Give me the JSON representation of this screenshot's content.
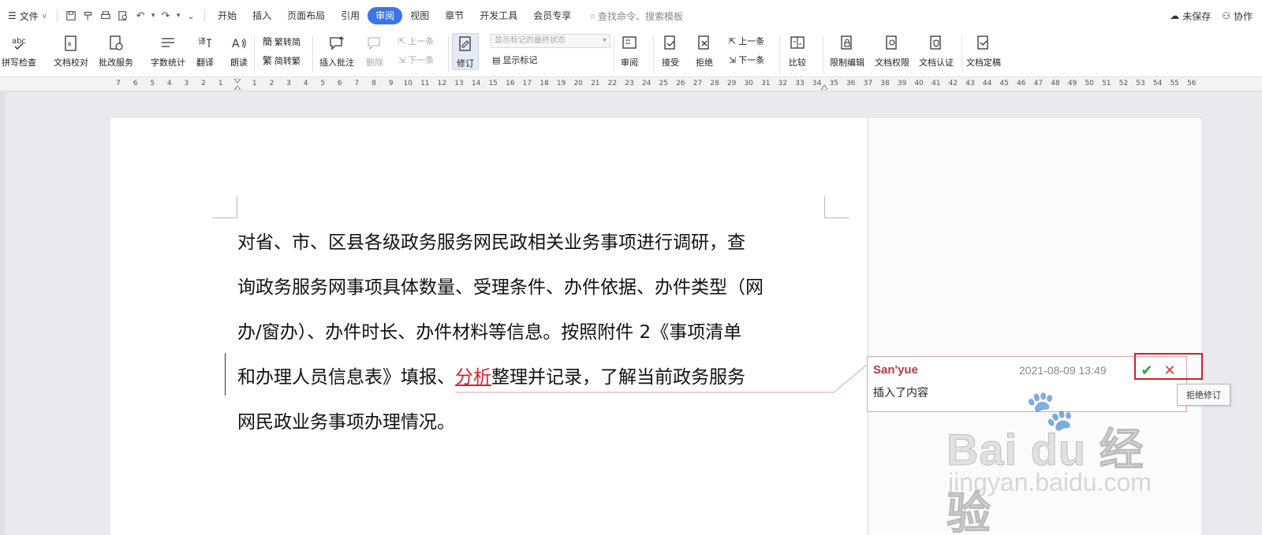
{
  "menubar": {
    "file_label": "文件",
    "tabs": [
      "开始",
      "插入",
      "页面布局",
      "引用",
      "审阅",
      "视图",
      "章节",
      "开发工具",
      "会员专享"
    ],
    "active_tab": "审阅",
    "search_placeholder": "查找命令、搜索模板",
    "unsaved_label": "未保存",
    "collab_label": "协作"
  },
  "ribbon": {
    "spell_check": "拼写检查",
    "doc_proof": "文档校对",
    "grading_service": "批改服务",
    "word_count": "字数统计",
    "translate": "翻译",
    "read_aloud": "朗读",
    "trad_to_simp": "繁转简",
    "simp_to_trad": "简转繁",
    "insert_comment": "插入批注",
    "delete": "删除",
    "prev_comment": "上一条",
    "next_comment": "下一条",
    "revision": "修订",
    "markup_state_placeholder": "显示标记的最终状态",
    "show_markup": "显示标记",
    "review": "审阅",
    "accept": "接受",
    "reject": "拒绝",
    "prev_change": "上一条",
    "next_change": "下一条",
    "compare": "比较",
    "restrict_edit": "限制编辑",
    "doc_permission": "文档权限",
    "doc_cert": "文档认证",
    "doc_finalize": "文档定稿"
  },
  "ruler": {
    "numbers": [
      "7",
      "6",
      "5",
      "4",
      "3",
      "2",
      "1",
      "",
      "1",
      "2",
      "3",
      "4",
      "5",
      "6",
      "7",
      "8",
      "9",
      "10",
      "11",
      "12",
      "13",
      "14",
      "15",
      "16",
      "17",
      "18",
      "19",
      "20",
      "21",
      "22",
      "23",
      "24",
      "25",
      "26",
      "27",
      "28",
      "29",
      "30",
      "31",
      "32",
      "33",
      "34",
      "35",
      "36",
      "37",
      "38",
      "39",
      "40",
      "41",
      "42",
      "43",
      "44",
      "45",
      "46",
      "47",
      "48",
      "49",
      "50",
      "51",
      "52",
      "53",
      "54",
      "55",
      "56"
    ]
  },
  "document": {
    "line1": "对省、市、区县各级政务服务网民政相关业务事项进行调研，查",
    "line2": "询政务服务网事项具体数量、受理条件、办件依据、办件类型（网",
    "line3": "办/窗办）、办件时长、办件材料等信息。按照附件 2《事项清单",
    "line4_before": "和办理人员信息表》填报、",
    "line4_inserted": "分析",
    "line4_after": "整理并记录，了解当前政务服务",
    "line5": "网民政业务事项办理情况。"
  },
  "revision_balloon": {
    "author": "San'yue",
    "timestamp": "2021-08-09 13:49",
    "description": "插入了内容",
    "accept_icon": "check-icon",
    "reject_icon": "close-icon",
    "tooltip": "拒绝修订"
  },
  "watermark": {
    "brand": "Bai du 经验",
    "url": "jingyan.baidu.com"
  },
  "colors": {
    "active_tab": "#3b74e6",
    "inserted_text": "#d2222d",
    "author": "#b43a44",
    "highlight_box": "#c7232f",
    "accept": "#29a33b",
    "reject": "#d2393f"
  }
}
